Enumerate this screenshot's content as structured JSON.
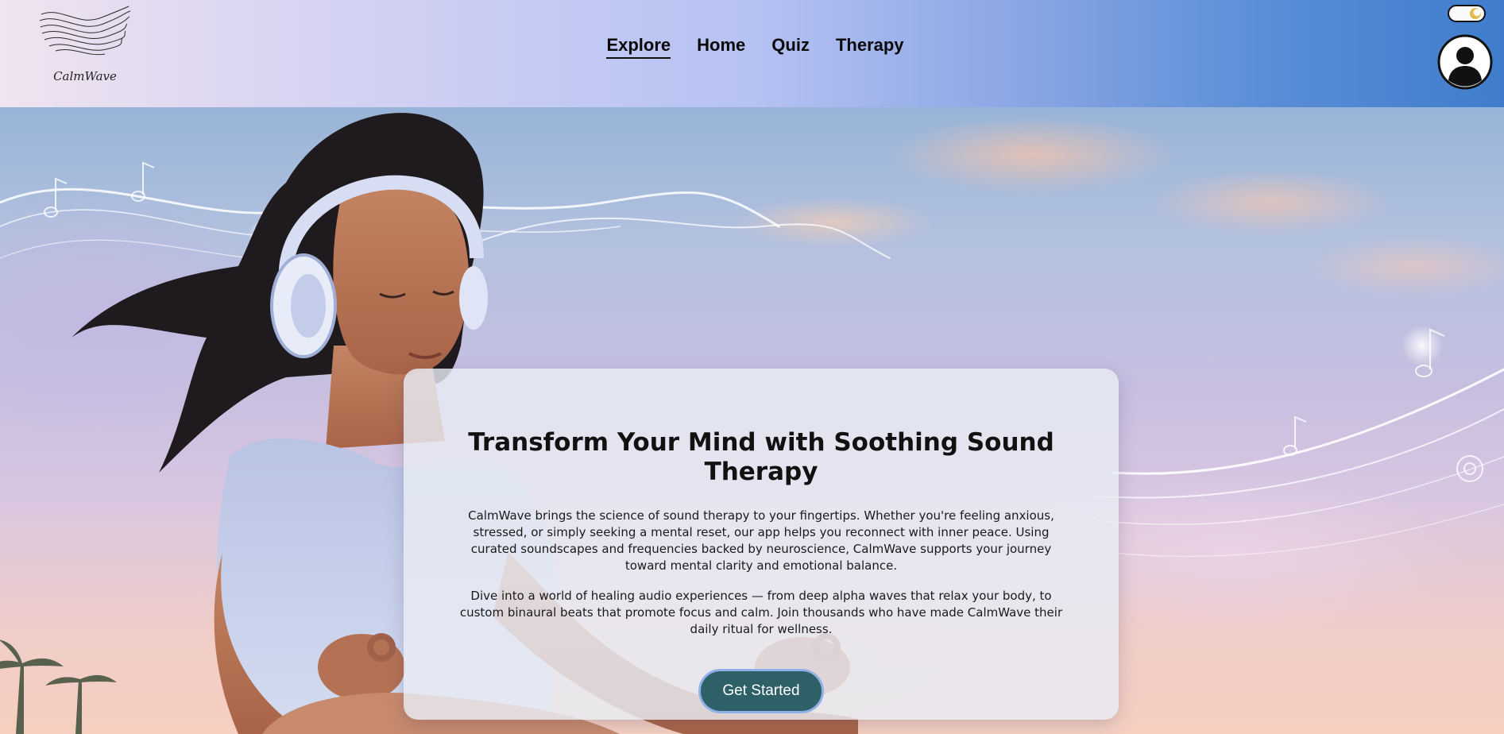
{
  "brand": {
    "name": "CalmWave",
    "logo_icon": "wave-lines-icon"
  },
  "nav": {
    "items": [
      {
        "label": "Explore",
        "active": true
      },
      {
        "label": "Home",
        "active": false
      },
      {
        "label": "Quiz",
        "active": false
      },
      {
        "label": "Therapy",
        "active": false
      }
    ]
  },
  "header_controls": {
    "theme_toggle_icon": "moon-toggle-icon",
    "avatar_icon": "user-avatar-icon"
  },
  "hero": {
    "background_icon": "meditating-woman-headphones-illustration",
    "title": "Transform Your Mind with Soothing Sound Therapy",
    "paragraphs": [
      "CalmWave brings the science of sound therapy to your fingertips. Whether you're feeling anxious, stressed, or simply seeking a mental reset, our app helps you reconnect with inner peace. Using curated soundscapes and frequencies backed by neuroscience, CalmWave supports your journey toward mental clarity and emotional balance.",
      "Dive into a world of healing audio experiences — from deep alpha waves that relax your body, to custom binaural beats that promote focus and calm. Join thousands who have made CalmWave their daily ritual for wellness."
    ],
    "cta_label": "Get Started"
  },
  "colors": {
    "cta_background": "#2e6068",
    "cta_border": "#8fb0e6",
    "header_gradient_start": "#efe4f0",
    "header_gradient_end": "#3f7dcc"
  }
}
